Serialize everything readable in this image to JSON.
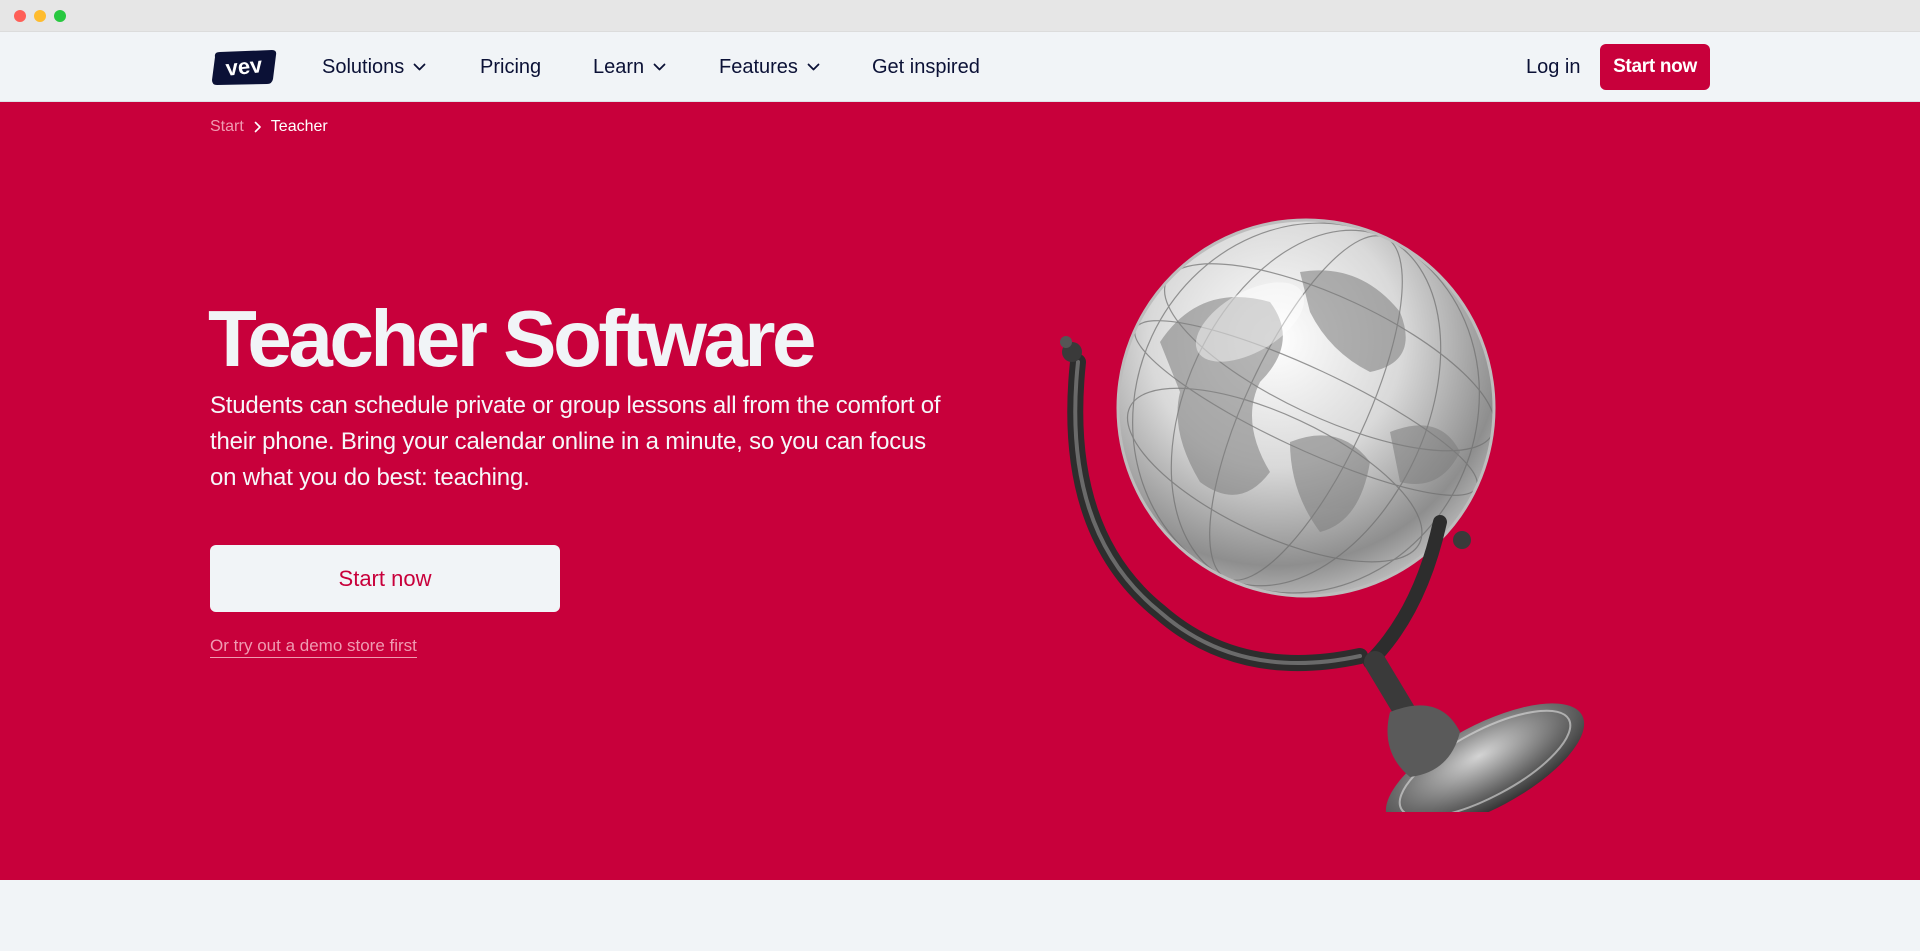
{
  "brand": {
    "logo_text": "vev",
    "accent_color": "#c8003b",
    "dark_color": "#0b1136"
  },
  "nav": {
    "items": [
      {
        "label": "Solutions",
        "has_dropdown": true
      },
      {
        "label": "Pricing",
        "has_dropdown": false
      },
      {
        "label": "Learn",
        "has_dropdown": true
      },
      {
        "label": "Features",
        "has_dropdown": true
      },
      {
        "label": "Get inspired",
        "has_dropdown": false
      }
    ],
    "login_label": "Log in",
    "start_label": "Start now"
  },
  "breadcrumb": {
    "items": [
      "Start",
      "Teacher"
    ]
  },
  "hero": {
    "title": "Teacher Software",
    "description": "Students can schedule private or group lessons all from the comfort of their phone. Bring your calendar online in a minute, so you can focus on what you do best: teaching.",
    "cta_label": "Start now",
    "demo_link": "Or try out a demo store first",
    "background_color": "#c8003b"
  },
  "icons": [
    "chevron-down-icon",
    "chevron-right-icon",
    "globe-illustration"
  ]
}
